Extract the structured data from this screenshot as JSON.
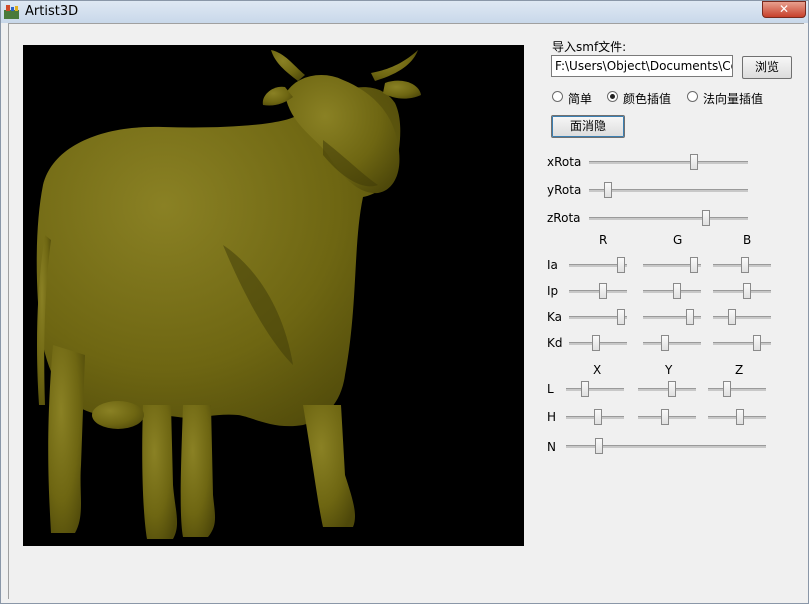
{
  "window": {
    "title": "Artist3D",
    "close_label": "✕"
  },
  "file": {
    "label": "导入smf文件:",
    "path": "F:\\Users\\Object\\Documents\\Cou",
    "browse_label": "浏览"
  },
  "shading": {
    "options": [
      {
        "label": "简单",
        "checked": false
      },
      {
        "label": "颜色插值",
        "checked": true
      },
      {
        "label": "法向量插值",
        "checked": false
      }
    ]
  },
  "hidden_surface_button": "面消隐",
  "rotation": [
    {
      "label": "xRota",
      "value": 0.67
    },
    {
      "label": "yRota",
      "value": 0.1
    },
    {
      "label": "zRota",
      "value": 0.75
    }
  ],
  "material": {
    "columns": [
      "R",
      "G",
      "B"
    ],
    "rows": [
      {
        "label": "Ia",
        "values": [
          0.95,
          0.93,
          0.55
        ]
      },
      {
        "label": "Ip",
        "values": [
          0.6,
          0.6,
          0.6
        ]
      },
      {
        "label": "Ka",
        "values": [
          0.95,
          0.85,
          0.3
        ]
      },
      {
        "label": "Kd",
        "values": [
          0.45,
          0.35,
          0.8
        ]
      }
    ]
  },
  "light": {
    "columns": [
      "X",
      "Y",
      "Z"
    ],
    "rows": [
      {
        "label": "L",
        "values": [
          0.3,
          0.6,
          0.3
        ]
      },
      {
        "label": "H",
        "values": [
          0.55,
          0.45,
          0.55
        ]
      }
    ]
  },
  "n": {
    "label": "N",
    "value": 0.15
  },
  "colors": {
    "cow": "#6e6612",
    "viewport_bg": "#000000"
  }
}
